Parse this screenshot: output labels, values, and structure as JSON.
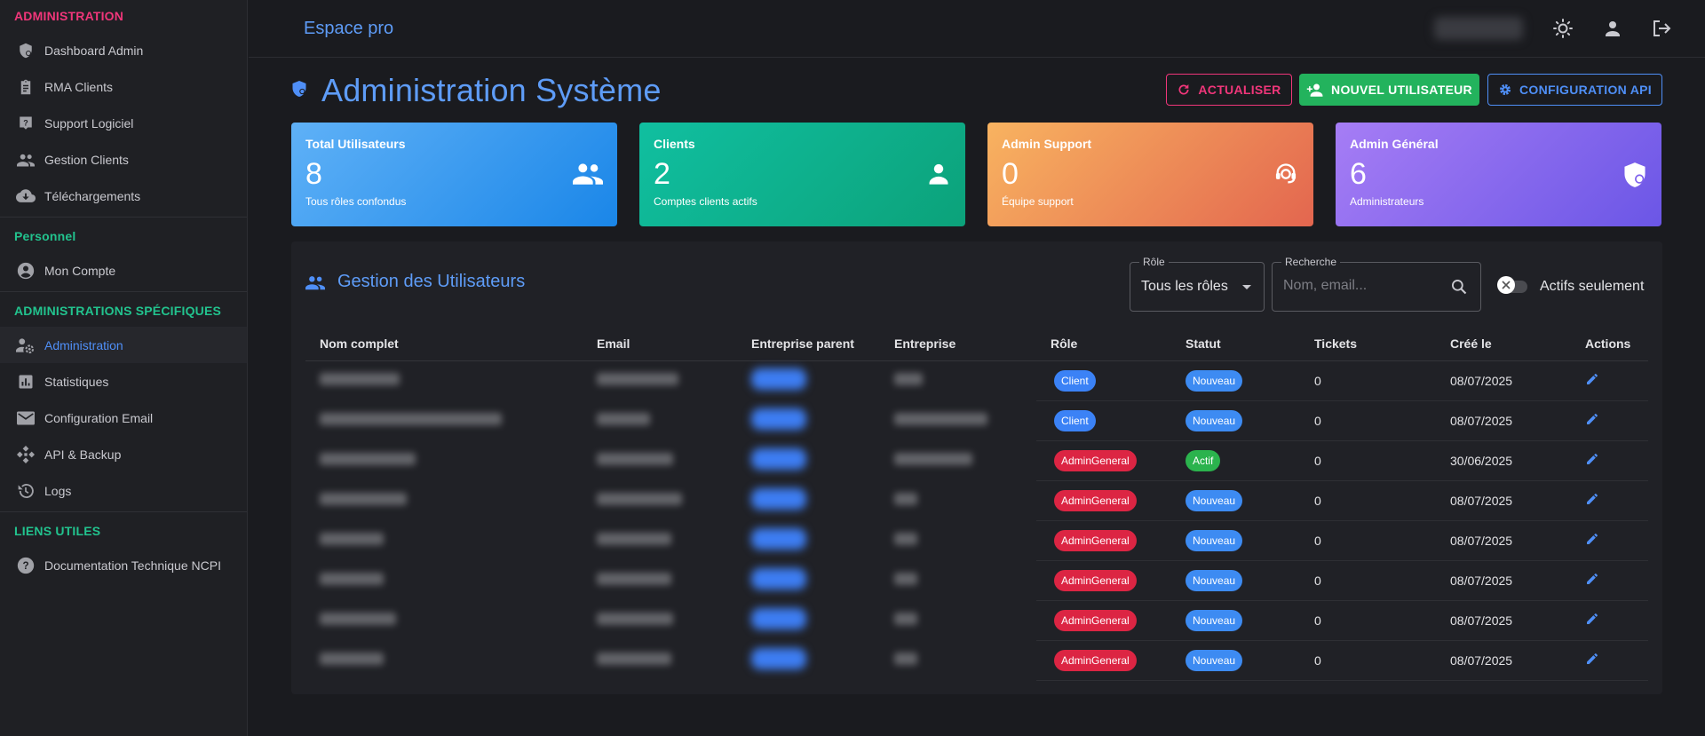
{
  "sidebar": {
    "sections": {
      "admin": "ADMINISTRATION",
      "personal": "Personnel",
      "specific": "ADMINISTRATIONS SPÉCIFIQUES",
      "links": "LIENS UTILES"
    },
    "items": {
      "dashboard": "Dashboard Admin",
      "rma": "RMA Clients",
      "support": "Support Logiciel",
      "clients": "Gestion Clients",
      "downloads": "Téléchargements",
      "account": "Mon Compte",
      "administration": "Administration",
      "stats": "Statistiques",
      "email": "Configuration Email",
      "api": "API & Backup",
      "logs": "Logs",
      "docs": "Documentation Technique NCPI"
    }
  },
  "topbar": {
    "brand": "Espace pro"
  },
  "header": {
    "title": "Administration Système",
    "refresh_label": "ACTUALISER",
    "new_user_label": "NOUVEL UTILISATEUR",
    "config_label": "CONFIGURATION API"
  },
  "stats": {
    "total": {
      "title": "Total Utilisateurs",
      "value": "8",
      "sub": "Tous rôles confondus"
    },
    "clients": {
      "title": "Clients",
      "value": "2",
      "sub": "Comptes clients actifs"
    },
    "support": {
      "title": "Admin Support",
      "value": "0",
      "sub": "Équipe support"
    },
    "general": {
      "title": "Admin Général",
      "value": "6",
      "sub": "Administrateurs"
    }
  },
  "users": {
    "title": "Gestion des Utilisateurs",
    "role_filter": {
      "label": "Rôle",
      "value": "Tous les rôles"
    },
    "search": {
      "label": "Recherche",
      "placeholder": "Nom, email..."
    },
    "active_only_label": "Actifs seulement",
    "columns": {
      "name": "Nom complet",
      "email": "Email",
      "parent": "Entreprise parent",
      "company": "Entreprise",
      "role": "Rôle",
      "status": "Statut",
      "tickets": "Tickets",
      "created": "Créé le",
      "actions": "Actions"
    },
    "rows": [
      {
        "role": "Client",
        "status": "Nouveau",
        "tickets": "0",
        "created": "08/07/2025"
      },
      {
        "role": "Client",
        "status": "Nouveau",
        "tickets": "0",
        "created": "08/07/2025"
      },
      {
        "role": "AdminGeneral",
        "status": "Actif",
        "tickets": "0",
        "created": "30/06/2025"
      },
      {
        "role": "AdminGeneral",
        "status": "Nouveau",
        "tickets": "0",
        "created": "08/07/2025"
      },
      {
        "role": "AdminGeneral",
        "status": "Nouveau",
        "tickets": "0",
        "created": "08/07/2025"
      },
      {
        "role": "AdminGeneral",
        "status": "Nouveau",
        "tickets": "0",
        "created": "08/07/2025"
      },
      {
        "role": "AdminGeneral",
        "status": "Nouveau",
        "tickets": "0",
        "created": "08/07/2025"
      },
      {
        "role": "AdminGeneral",
        "status": "Nouveau",
        "tickets": "0",
        "created": "08/07/2025"
      }
    ]
  },
  "colors": {
    "accent": "#5e9cf7",
    "pink": "#f0367a",
    "green": "#22c38e",
    "client_chip": "#3b82f6",
    "admin_chip": "#dc2543",
    "new_chip": "#3d8bf2",
    "active_chip": "#2bb34d"
  }
}
